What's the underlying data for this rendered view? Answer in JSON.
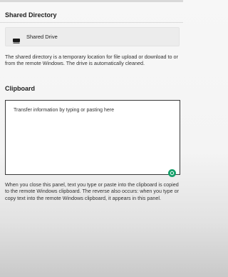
{
  "shared_directory": {
    "title": "Shared Directory",
    "drive": {
      "icon": "drive-icon",
      "label": "Shared Drive"
    },
    "description": "The shared directory is a temporary location for file upload or download to or from the remote Windows. The drive is automatically cleaned."
  },
  "clipboard": {
    "title": "Clipboard",
    "placeholder": "Transfer information by typing or pasting here",
    "value": "",
    "indicator_icon": "grammar-check-icon",
    "indicator_color": "#16a06a",
    "description": "When you close this panel, text you type or paste into the clipboard is copied to the remote Windows clipboard. The reverse also occurs: when you type or copy text into the remote Windows clipboard, it appears in this panel."
  }
}
